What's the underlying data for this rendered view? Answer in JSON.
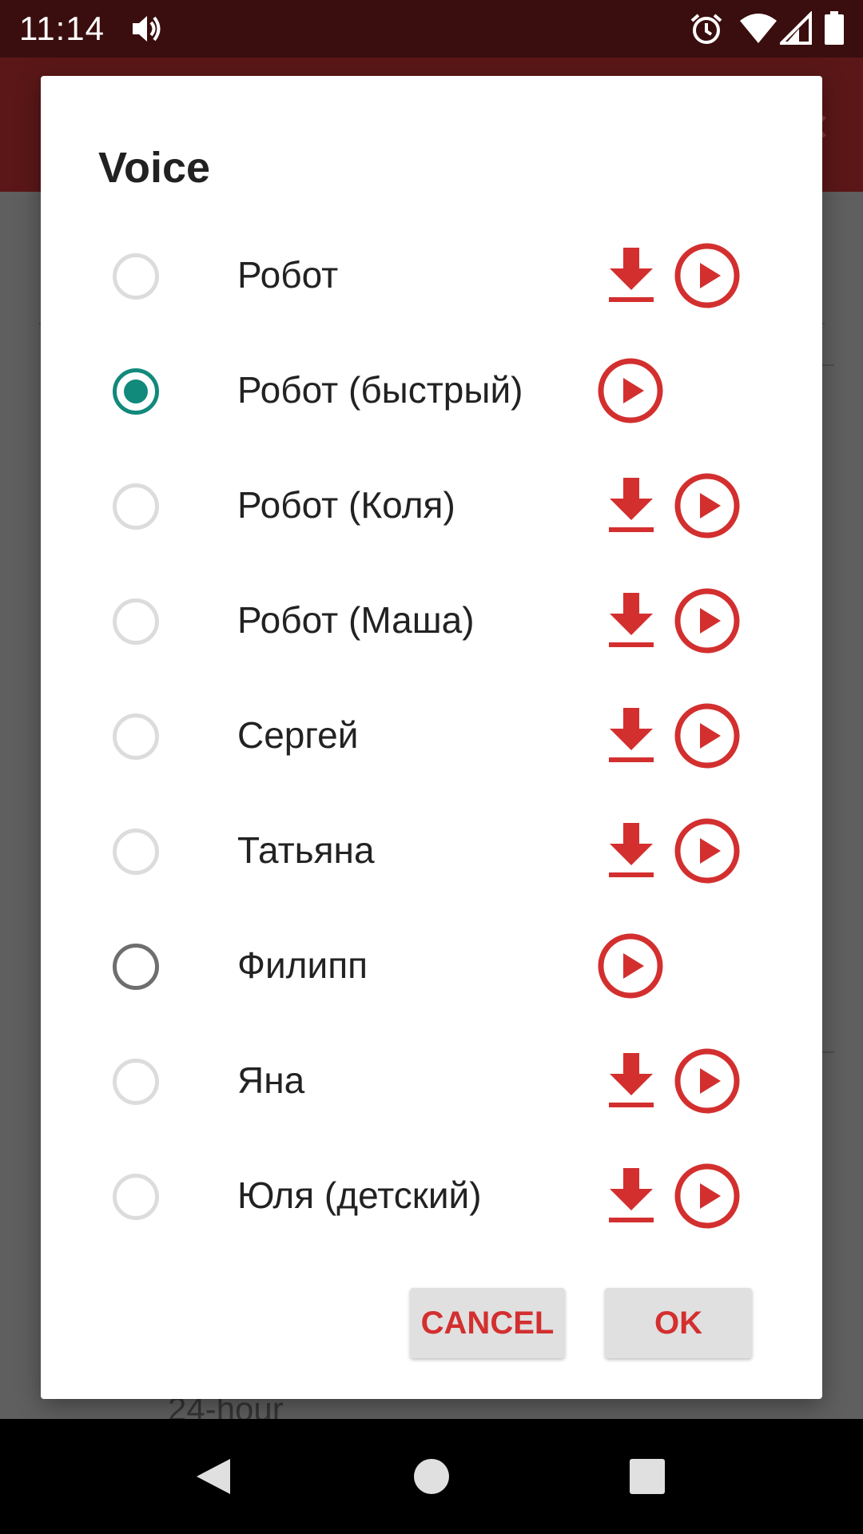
{
  "status_bar": {
    "time": "11:14",
    "icons": [
      "volume-icon",
      "alarm-icon",
      "wifi-icon",
      "signal-icon",
      "battery-icon"
    ]
  },
  "background": {
    "partial_text": "24-hour"
  },
  "dialog": {
    "title": "Voice",
    "options": [
      {
        "label": "Робот",
        "selected": false,
        "downloadable": true
      },
      {
        "label": "Робот (быстрый)",
        "selected": true,
        "downloadable": false
      },
      {
        "label": "Робот (Коля)",
        "selected": false,
        "downloadable": true
      },
      {
        "label": "Робот (Маша)",
        "selected": false,
        "downloadable": true
      },
      {
        "label": "Сергей",
        "selected": false,
        "downloadable": true
      },
      {
        "label": "Татьяна",
        "selected": false,
        "downloadable": true
      },
      {
        "label": "Филипп",
        "selected": false,
        "downloadable": false
      },
      {
        "label": "Яна",
        "selected": false,
        "downloadable": true
      },
      {
        "label": "Юля (детский)",
        "selected": false,
        "downloadable": true
      }
    ],
    "cancel_label": "CANCEL",
    "ok_label": "OK"
  },
  "colors": {
    "accent_red": "#d32f2f",
    "radio_selected": "#11897b",
    "status_bar": "#3a0e0e"
  }
}
